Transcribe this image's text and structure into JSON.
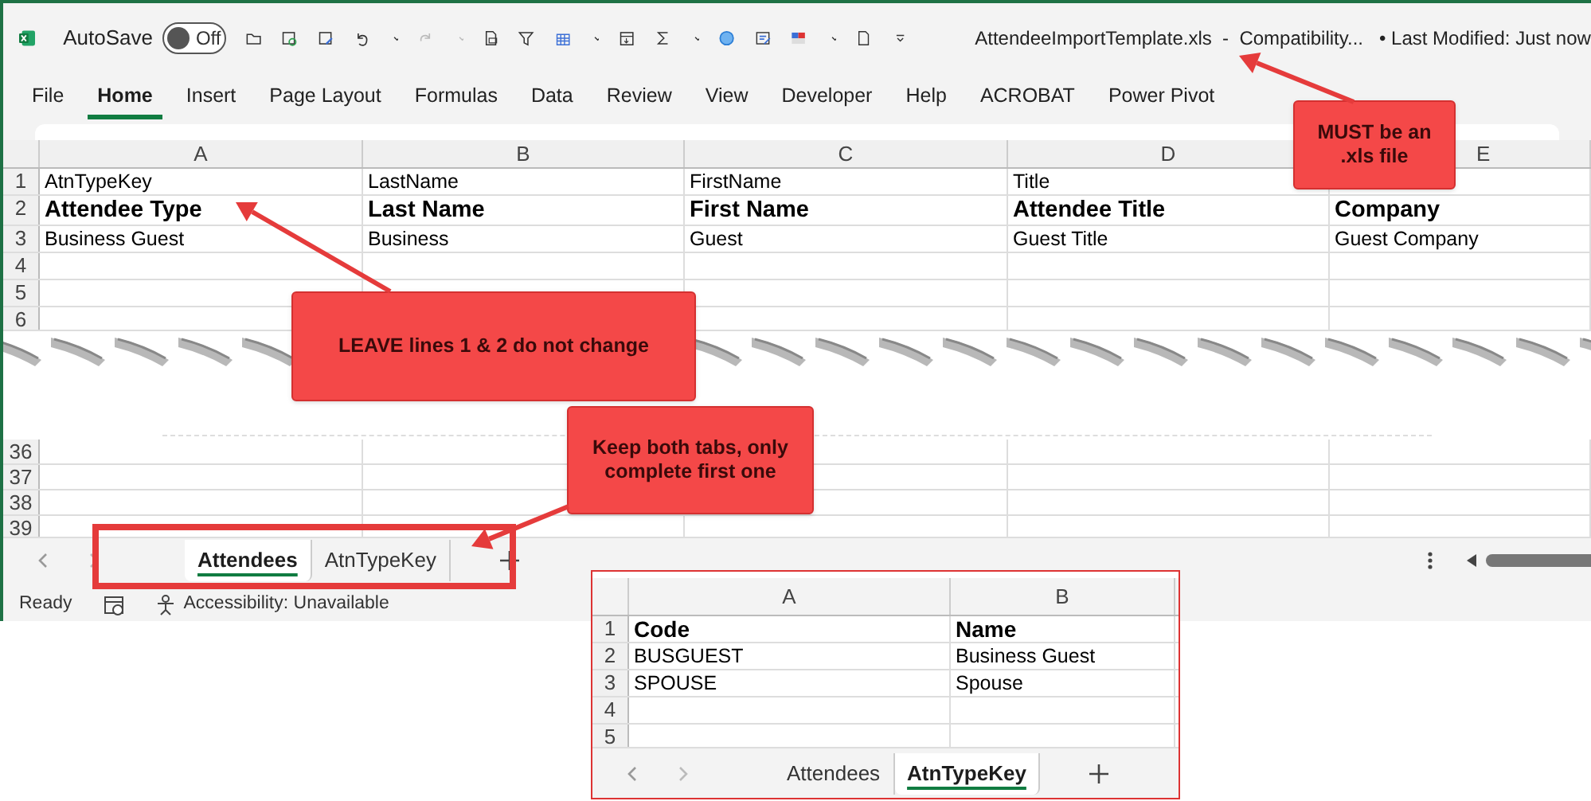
{
  "title_bar": {
    "autosave_label": "AutoSave",
    "autosave_toggle": {
      "label": "Off",
      "on": false
    },
    "file_title": "AttendeeImportTemplate.xls  -  Compatibility...",
    "last_modified": "• Last Modified: Just now"
  },
  "ribbon_tabs": [
    {
      "label": "File",
      "selected": false
    },
    {
      "label": "Home",
      "selected": true
    },
    {
      "label": "Insert",
      "selected": false
    },
    {
      "label": "Page Layout",
      "selected": false
    },
    {
      "label": "Formulas",
      "selected": false
    },
    {
      "label": "Data",
      "selected": false
    },
    {
      "label": "Review",
      "selected": false
    },
    {
      "label": "View",
      "selected": false
    },
    {
      "label": "Developer",
      "selected": false
    },
    {
      "label": "Help",
      "selected": false
    },
    {
      "label": "ACROBAT",
      "selected": false
    },
    {
      "label": "Power Pivot",
      "selected": false
    }
  ],
  "sheet": {
    "columns": [
      "A",
      "B",
      "C",
      "D",
      "E"
    ],
    "rows": [
      {
        "header": "1",
        "kind": "plain",
        "cells": [
          "AtnTypeKey",
          "LastName",
          "FirstName",
          "Title"
        ]
      },
      {
        "header": "2",
        "kind": "bold",
        "cells": [
          "Attendee Type",
          "Last Name",
          "First Name",
          "Attendee Title",
          "Company"
        ]
      },
      {
        "header": "3",
        "kind": "plain",
        "cells": [
          "Business Guest",
          "Business",
          "Guest",
          "Guest Title",
          "Guest Company"
        ]
      },
      {
        "header": "4",
        "kind": "plain"
      },
      {
        "header": "5",
        "kind": "plain"
      },
      {
        "header": "6",
        "kind": "plain"
      }
    ],
    "lower_rows": [
      "36",
      "37",
      "38",
      "39"
    ]
  },
  "sheet_tabs": [
    {
      "label": "Attendees",
      "selected": true
    },
    {
      "label": "AtnTypeKey",
      "selected": false
    }
  ],
  "status_bar": {
    "ready": "Ready",
    "accessibility": "Accessibility: Unavailable"
  },
  "inset": {
    "columns": [
      "A",
      "B"
    ],
    "rows": [
      {
        "header": "1",
        "kind": "bold",
        "cells": [
          "Code",
          "Name"
        ]
      },
      {
        "header": "2",
        "kind": "plain",
        "cells": [
          "BUSGUEST",
          "Business Guest"
        ]
      },
      {
        "header": "3",
        "kind": "plain",
        "cells": [
          "SPOUSE",
          "Spouse"
        ]
      },
      {
        "header": "4",
        "kind": "plain"
      },
      {
        "header": "5",
        "kind": "plain"
      }
    ],
    "sheet_tabs": [
      {
        "label": "Attendees",
        "selected": false
      },
      {
        "label": "AtnTypeKey",
        "selected": true
      }
    ]
  },
  "callouts": [
    {
      "text": "MUST be an .xls file"
    },
    {
      "text": "LEAVE lines 1 & 2 do not change"
    },
    {
      "text": "Keep both tabs, only complete first one"
    }
  ]
}
